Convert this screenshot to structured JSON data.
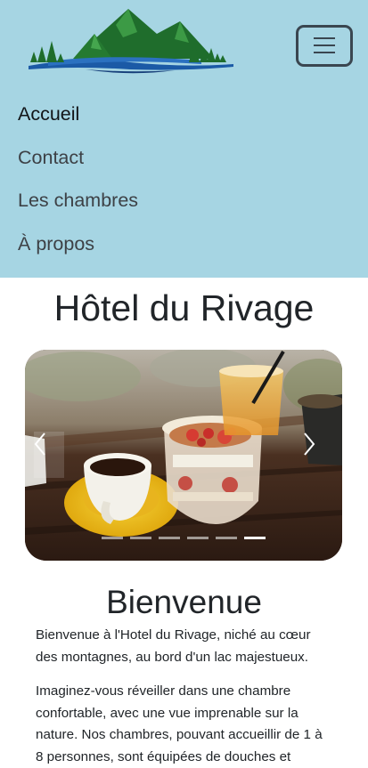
{
  "header": {
    "logo_icon": "mountain-lake-logo-icon",
    "menu_icon": "hamburger-menu-icon",
    "nav": [
      {
        "label": "Accueil",
        "active": true
      },
      {
        "label": "Contact",
        "active": false
      },
      {
        "label": "Les chambres",
        "active": false
      },
      {
        "label": "À propos",
        "active": false
      }
    ],
    "background": "#a6d5e3"
  },
  "main": {
    "title": "Hôtel du Rivage",
    "carousel": {
      "prev_icon": "chevron-left-icon",
      "next_icon": "chevron-right-icon",
      "slide_count": 6,
      "active_index": 5
    },
    "welcome_heading": "Bienvenue",
    "paragraphs": [
      "Bienvenue à l'Hotel du Rivage, niché au cœur des montagnes, au bord d'un lac majestueux.",
      "Imaginez-vous réveiller dans une chambre confortable, avec une vue imprenable sur la nature. Nos chambres, pouvant accueillir de 1 à 8 personnes, sont équipées de douches et"
    ]
  }
}
